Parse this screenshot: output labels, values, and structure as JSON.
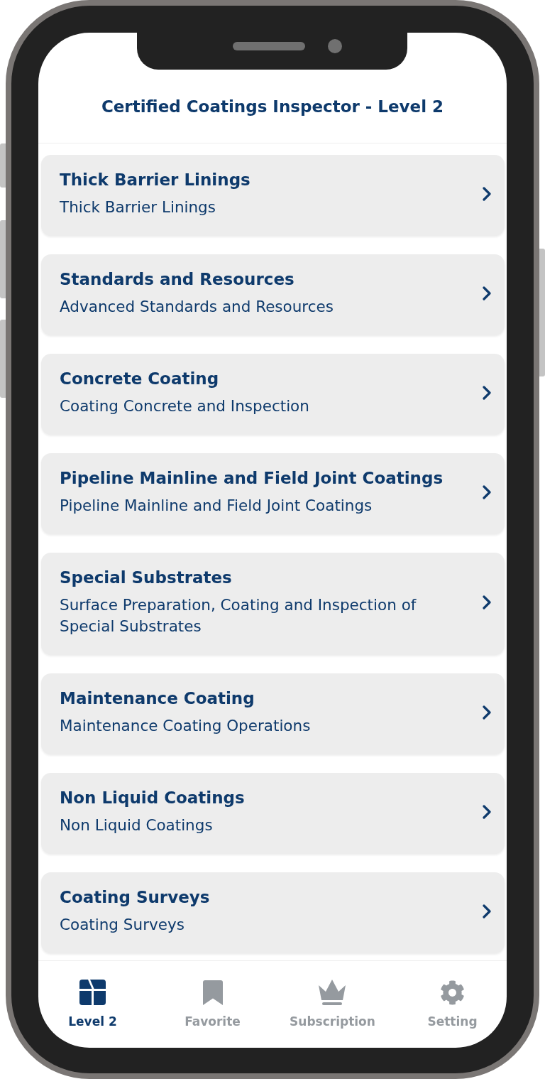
{
  "header": {
    "title": "Certified Coatings Inspector - Level 2"
  },
  "courses": [
    {
      "title": "Thick Barrier Linings",
      "subtitle": "Thick Barrier Linings"
    },
    {
      "title": "Standards and Resources",
      "subtitle": "Advanced Standards and Resources"
    },
    {
      "title": "Concrete Coating",
      "subtitle": "Coating Concrete and Inspection"
    },
    {
      "title": "Pipeline Mainline and Field Joint Coatings",
      "subtitle": "Pipeline Mainline and Field Joint Coatings"
    },
    {
      "title": "Special Substrates",
      "subtitle": "Surface Preparation, Coating and Inspection of Special Substrates"
    },
    {
      "title": "Maintenance Coating",
      "subtitle": "Maintenance Coating Operations"
    },
    {
      "title": "Non Liquid Coatings",
      "subtitle": "Non Liquid Coatings"
    },
    {
      "title": "Coating Surveys",
      "subtitle": "Coating Surveys"
    }
  ],
  "tab_bar": [
    {
      "kind": "layout",
      "label": "Level 2",
      "selected": true
    },
    {
      "kind": "bookmark",
      "label": "Favorite",
      "selected": false
    },
    {
      "kind": "crown",
      "label": "Subscription",
      "selected": false
    },
    {
      "kind": "gear",
      "label": "Setting",
      "selected": false
    }
  ]
}
